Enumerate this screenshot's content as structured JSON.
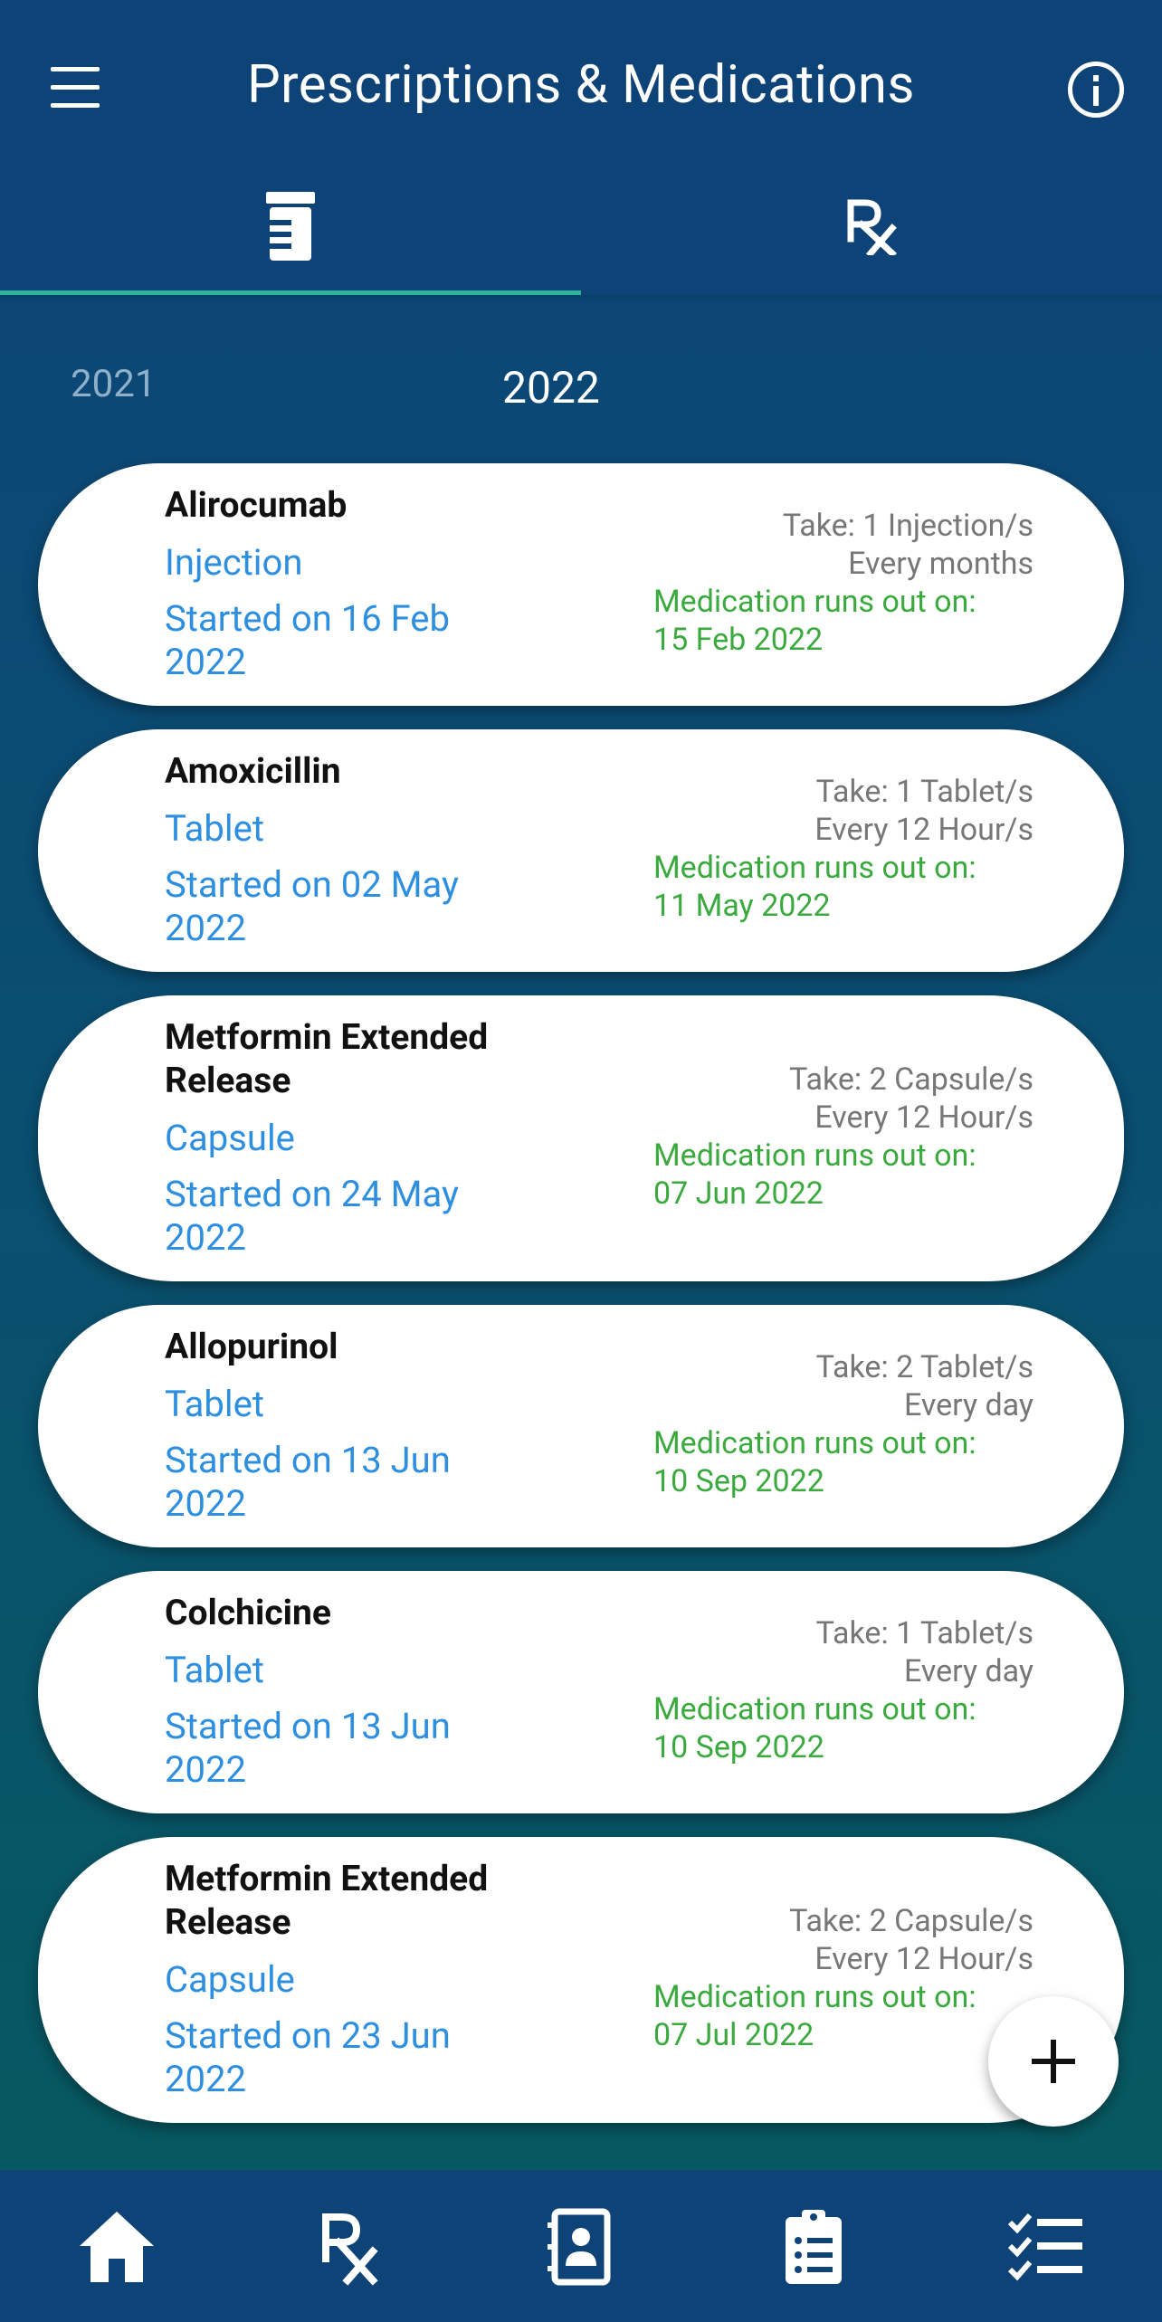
{
  "header": {
    "title": "Prescriptions & Medications"
  },
  "tabs": [
    {
      "name": "medications",
      "icon": "pill-bottle-icon",
      "active": true
    },
    {
      "name": "prescriptions",
      "icon": "rx-icon",
      "active": false
    }
  ],
  "years": {
    "previous": "2021",
    "current": "2022"
  },
  "medications": [
    {
      "name": "Alirocumab",
      "form": "Injection",
      "started": "Started on 16 Feb 2022",
      "take": "Take: 1 Injection/s",
      "frequency": "Every months",
      "runout_label": "Medication runs out on:",
      "runout_date": "15 Feb 2022"
    },
    {
      "name": "Amoxicillin",
      "form": "Tablet",
      "started": "Started on 02 May 2022",
      "take": "Take: 1 Tablet/s",
      "frequency": "Every 12 Hour/s",
      "runout_label": "Medication runs out on:",
      "runout_date": "11 May 2022"
    },
    {
      "name": "Metformin Extended Release",
      "form": "Capsule",
      "started": "Started on 24 May 2022",
      "take": "Take: 2 Capsule/s",
      "frequency": "Every 12 Hour/s",
      "runout_label": "Medication runs out on:",
      "runout_date": "07 Jun 2022"
    },
    {
      "name": "Allopurinol",
      "form": "Tablet",
      "started": "Started on 13 Jun 2022",
      "take": "Take: 2 Tablet/s",
      "frequency": "Every day",
      "runout_label": "Medication runs out on:",
      "runout_date": "10 Sep 2022"
    },
    {
      "name": "Colchicine",
      "form": "Tablet",
      "started": "Started on 13 Jun 2022",
      "take": "Take: 1 Tablet/s",
      "frequency": "Every day",
      "runout_label": "Medication runs out on:",
      "runout_date": "10 Sep 2022"
    },
    {
      "name": "Metformin Extended Release",
      "form": "Capsule",
      "started": "Started on 23 Jun 2022",
      "take": "Take: 2 Capsule/s",
      "frequency": "Every 12 Hour/s",
      "runout_label": "Medication runs out on:",
      "runout_date": "07 Jul 2022"
    }
  ],
  "fab": {
    "icon": "plus-icon"
  },
  "bottom_nav": [
    {
      "icon": "home-icon"
    },
    {
      "icon": "rx-icon"
    },
    {
      "icon": "contacts-icon"
    },
    {
      "icon": "clipboard-icon"
    },
    {
      "icon": "checklist-icon"
    }
  ],
  "colors": {
    "appbar": "#0d4377",
    "accent": "#2bb69a",
    "link_blue": "#2e8fe0",
    "runout_green": "#3aaa3e"
  }
}
